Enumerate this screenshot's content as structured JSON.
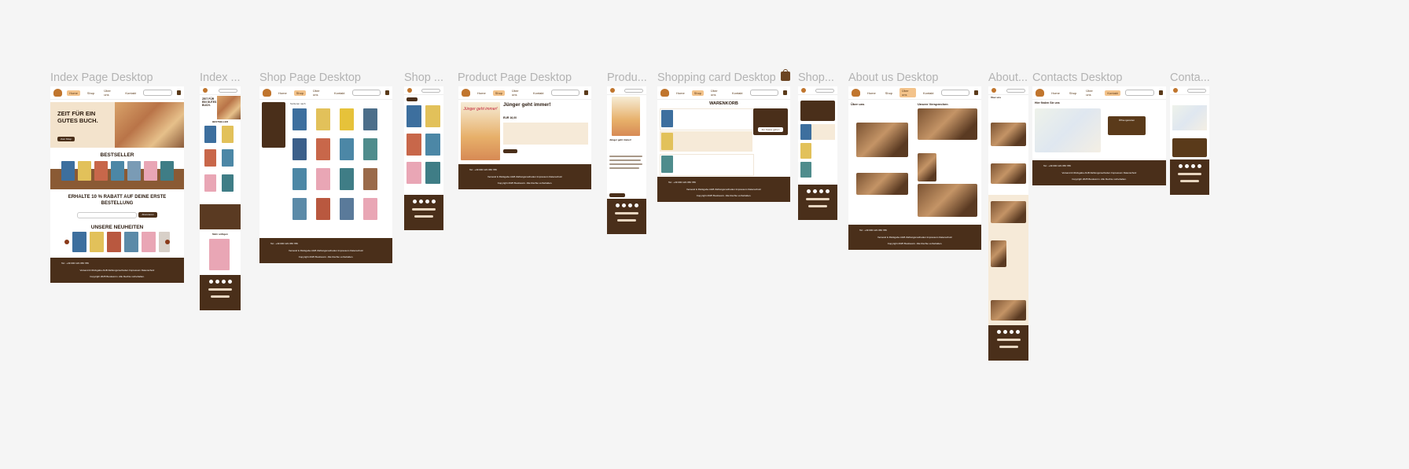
{
  "frames": {
    "index_desktop": "Index Page Desktop",
    "index_mobile": "Index ...",
    "shop_desktop": "Shop Page Desktop",
    "shop_mobile": "Shop ...",
    "product_desktop": "Product Page Desktop",
    "product_mobile": "Produ...",
    "cart_desktop": "Shopping card Desktop",
    "cart_mobile": "Shop...",
    "about_desktop": "About us Desktop",
    "about_mobile": "About...",
    "contacts_desktop": "Contacts Desktop",
    "contacts_mobile": "Conta..."
  },
  "nav": [
    "Home",
    "Shop",
    "Über uns",
    "Kontakt"
  ],
  "index": {
    "hero": "ZEIT FÜR EIN GUTES BUCH.",
    "hero_button": "Zum Shop",
    "bestseller": "BESTSELLER",
    "discount": "ERHALTE 10 % RABATT AUF DEINE ERSTE BESTELLUNG",
    "discount_button": "Abonnieren",
    "new": "UNSERE NEUHEITEN",
    "mobile_bestseller": "BESTSELLER",
    "mobile_more": "Mehr anfügen"
  },
  "shop": {
    "sort": "Sortieren nach"
  },
  "product": {
    "title": "Jünger geht immer!",
    "price": "EUR 16,00",
    "book_cover_title": "Jünger geht immer!"
  },
  "cart": {
    "title": "WARENKORB",
    "checkout": "Zur Kasse gehen"
  },
  "about": {
    "title": "Über uns",
    "promise": "Unsere Versprechen"
  },
  "contacts": {
    "title": "Hier finden Sie uns",
    "hours": "Öffnungszeiten"
  },
  "footer": {
    "phone": "Tel.: +49 000 123 456 789",
    "email": "info@bookworm.de",
    "links": "Versand & Rückgabe   AGB   Zahlungsmethoden   Impressum   Datenschutz",
    "copyright": "Copyright 2025 Bookworm. Alle Rechte vorbehalten."
  },
  "colors": {
    "brown": "#4a2f1a",
    "cream": "#f6ead8",
    "accent": "#f3c38b",
    "bg": "#f5f5f5"
  }
}
